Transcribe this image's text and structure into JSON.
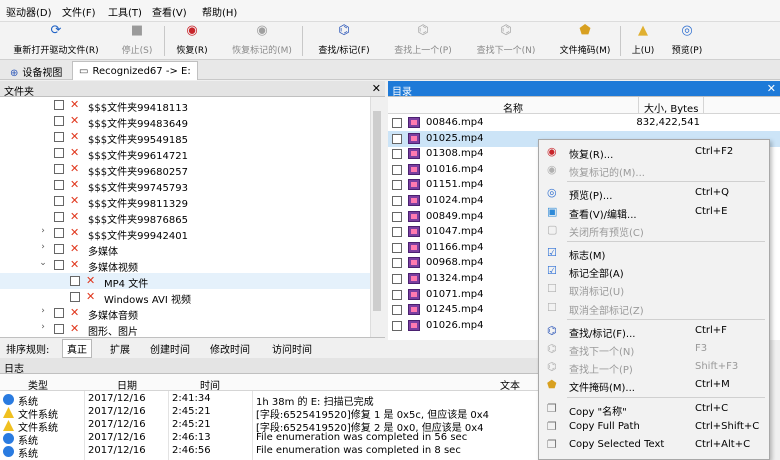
{
  "menu": [
    "驱动器(D)",
    "文件(F)",
    "工具(T)",
    "查看(V)",
    "帮助(H)"
  ],
  "toolbar": [
    {
      "label": "重新打开驱动文件(R)",
      "icon": "refresh-icon",
      "enabled": true
    },
    {
      "label": "停止(S)",
      "icon": "stop-icon",
      "enabled": false
    },
    {
      "label": "恢复(R)",
      "icon": "recover-icon",
      "enabled": true
    },
    {
      "label": "恢复标记的(M)",
      "icon": "recover-marked-icon",
      "enabled": false
    },
    {
      "label": "查找/标记(F)",
      "icon": "binoculars-icon",
      "enabled": true
    },
    {
      "label": "查找上一个(P)",
      "icon": "find-prev-icon",
      "enabled": false
    },
    {
      "label": "查找下一个(N)",
      "icon": "find-next-icon",
      "enabled": false
    },
    {
      "label": "文件掩码(M)",
      "icon": "file-mask-icon",
      "enabled": true
    },
    {
      "label": "上(U)",
      "icon": "up-folder-icon",
      "enabled": true
    },
    {
      "label": "预览(P)",
      "icon": "preview-icon",
      "enabled": true
    }
  ],
  "tabs": [
    {
      "label": "设备视图",
      "icon": "device-view-icon"
    },
    {
      "label": "Recognized67 -> E:",
      "icon": "drive-icon"
    }
  ],
  "folders_panel": {
    "title": "文件夹",
    "rows": [
      {
        "label": "$$$文件夹99418113",
        "level": 0,
        "expander": "",
        "checked": false
      },
      {
        "label": "$$$文件夹99483649",
        "level": 0,
        "expander": "",
        "checked": false
      },
      {
        "label": "$$$文件夹99549185",
        "level": 0,
        "expander": "",
        "checked": false
      },
      {
        "label": "$$$文件夹99614721",
        "level": 0,
        "expander": "",
        "checked": false
      },
      {
        "label": "$$$文件夹99680257",
        "level": 0,
        "expander": "",
        "checked": false
      },
      {
        "label": "$$$文件夹99745793",
        "level": 0,
        "expander": "",
        "checked": false
      },
      {
        "label": "$$$文件夹99811329",
        "level": 0,
        "expander": "",
        "checked": false
      },
      {
        "label": "$$$文件夹99876865",
        "level": 0,
        "expander": "",
        "checked": false
      },
      {
        "label": "$$$文件夹99942401",
        "level": 0,
        "expander": "›",
        "checked": false
      },
      {
        "label": "多媒体",
        "level": 0,
        "expander": "›",
        "checked": false
      },
      {
        "label": "多媒体视频",
        "level": 0,
        "expander": "⌄",
        "checked": false
      },
      {
        "label": "MP4 文件",
        "level": 1,
        "expander": "",
        "checked": false,
        "selected": true
      },
      {
        "label": "Windows AVI 视频",
        "level": 1,
        "expander": "",
        "checked": false
      },
      {
        "label": "多媒体音频",
        "level": 0,
        "expander": "›",
        "checked": false
      },
      {
        "label": "图形、图片",
        "level": 0,
        "expander": "›",
        "checked": false
      }
    ]
  },
  "sort_bar": {
    "label": "排序规则:",
    "items": [
      "真正",
      "扩展",
      "创建时间",
      "修改时间",
      "访问时间"
    ],
    "active": 0
  },
  "directory_panel": {
    "title": "目录",
    "col_name": "名称",
    "col_size": "大小, Bytes",
    "rows": [
      {
        "name": "00846.mp4",
        "size": "832,422,541"
      },
      {
        "name": "01025.mp4",
        "size": "",
        "selected": true
      },
      {
        "name": "01308.mp4",
        "size": ""
      },
      {
        "name": "01016.mp4",
        "size": ""
      },
      {
        "name": "01151.mp4",
        "size": ""
      },
      {
        "name": "01024.mp4",
        "size": ""
      },
      {
        "name": "00849.mp4",
        "size": ""
      },
      {
        "name": "01047.mp4",
        "size": ""
      },
      {
        "name": "01166.mp4",
        "size": ""
      },
      {
        "name": "00968.mp4",
        "size": ""
      },
      {
        "name": "01324.mp4",
        "size": ""
      },
      {
        "name": "01071.mp4",
        "size": ""
      },
      {
        "name": "01245.mp4",
        "size": ""
      },
      {
        "name": "01026.mp4",
        "size": ""
      }
    ]
  },
  "context_menu": [
    {
      "label": "恢复(R)...",
      "shortcut": "Ctrl+F2",
      "icon": "recover-icon",
      "enabled": true
    },
    {
      "label": "恢复标记的(M)...",
      "shortcut": "",
      "icon": "recover-marked-icon",
      "enabled": false
    },
    {
      "sep": true
    },
    {
      "label": "预览(P)...",
      "shortcut": "Ctrl+Q",
      "icon": "preview-icon",
      "enabled": true
    },
    {
      "label": "查看(V)/编辑...",
      "shortcut": "Ctrl+E",
      "icon": "view-edit-icon",
      "enabled": true
    },
    {
      "label": "关闭所有预览(C)",
      "shortcut": "",
      "icon": "close-previews-icon",
      "enabled": false
    },
    {
      "sep": true
    },
    {
      "label": "标志(M)",
      "shortcut": "",
      "icon": "mark-checkbox-icon",
      "enabled": true
    },
    {
      "label": "标记全部(A)",
      "shortcut": "",
      "icon": "mark-all-icon",
      "enabled": true
    },
    {
      "label": "取消标记(U)",
      "shortcut": "",
      "icon": "unmark-icon",
      "enabled": false
    },
    {
      "label": "取消全部标记(Z)",
      "shortcut": "",
      "icon": "unmark-all-icon",
      "enabled": false
    },
    {
      "sep": true
    },
    {
      "label": "查找/标记(F)...",
      "shortcut": "Ctrl+F",
      "icon": "binoculars-icon",
      "enabled": true
    },
    {
      "label": "查找下一个(N)",
      "shortcut": "F3",
      "icon": "find-next-icon",
      "enabled": false
    },
    {
      "label": "查找上一个(P)",
      "shortcut": "Shift+F3",
      "icon": "find-prev-icon",
      "enabled": false
    },
    {
      "label": "文件掩码(M)...",
      "shortcut": "Ctrl+M",
      "icon": "file-mask-icon",
      "enabled": true
    },
    {
      "sep": true
    },
    {
      "label": "Copy \"名称\"",
      "shortcut": "Ctrl+C",
      "icon": "copy-icon",
      "enabled": true
    },
    {
      "label": "Copy Full Path",
      "shortcut": "Ctrl+Shift+C",
      "icon": "copy-path-icon",
      "enabled": true
    },
    {
      "label": "Copy Selected Text",
      "shortcut": "Ctrl+Alt+C",
      "icon": "copy-text-icon",
      "enabled": true
    }
  ],
  "log_panel": {
    "title": "日志",
    "columns": {
      "type": "类型",
      "date": "日期",
      "time": "时间",
      "text": "文本"
    },
    "rows": [
      {
        "type": "系统",
        "level": "info",
        "date": "2017/12/16",
        "time": "2:41:34",
        "text": "1h 38m 的 E: 扫描已完成"
      },
      {
        "type": "文件系统",
        "level": "warn",
        "date": "2017/12/16",
        "time": "2:45:21",
        "text": "[字段:6525419520]修复 1 是 0x5c, 但应该是 0x4"
      },
      {
        "type": "文件系统",
        "level": "warn",
        "date": "2017/12/16",
        "time": "2:45:21",
        "text": "[字段:6525419520]修复 2 是 0x0, 但应该是 0x4"
      },
      {
        "type": "系统",
        "level": "info",
        "date": "2017/12/16",
        "time": "2:46:13",
        "text": "File enumeration was completed in 56 sec"
      },
      {
        "type": "系统",
        "level": "info",
        "date": "2017/12/16",
        "time": "2:46:56",
        "text": "File enumeration was completed in 8 sec"
      }
    ]
  }
}
